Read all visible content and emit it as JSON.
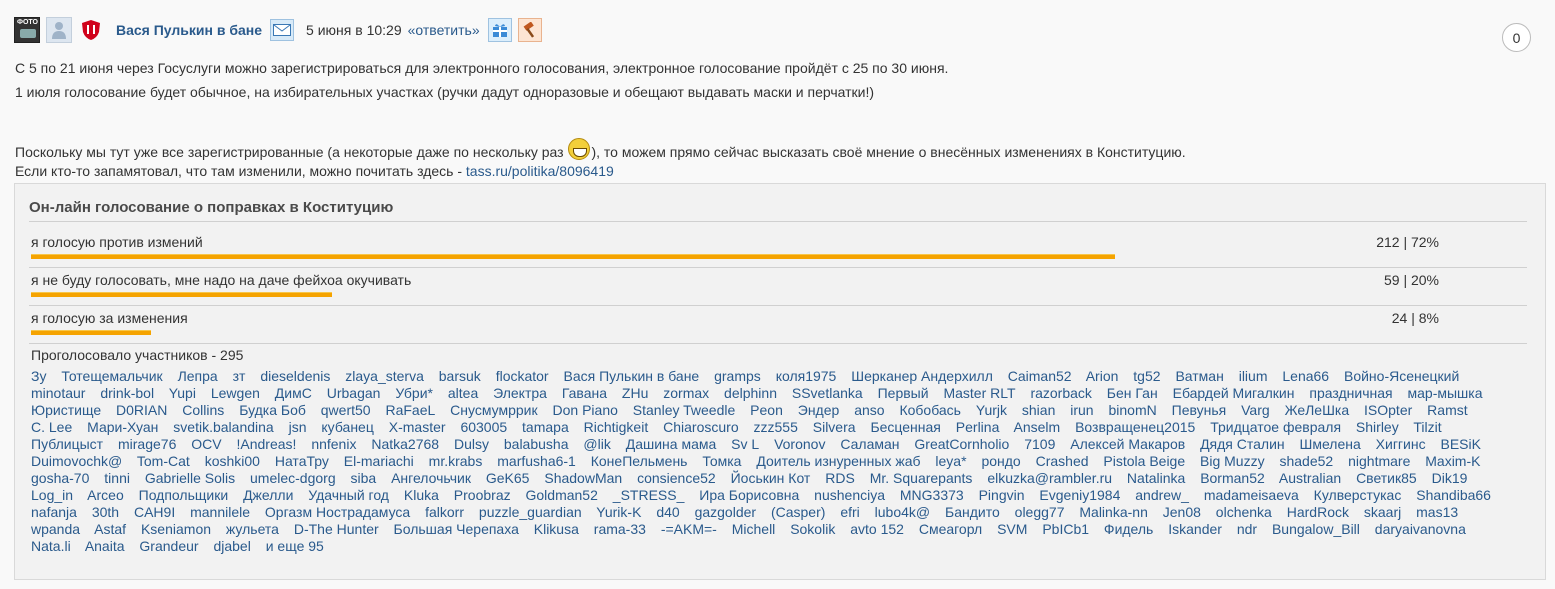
{
  "post": {
    "author": "Вася Пулькин в бане",
    "date": "5 июня в 10:29",
    "reply_label": "«ответить»",
    "counter": "0",
    "photo_badge": "ФОТО",
    "icons": [
      "photo-icon",
      "avatar-icon",
      "shield-icon",
      "mail-icon",
      "gift-icon",
      "hammer-icon"
    ],
    "paragraph1": "С 5 по 21 июня через Госуслуги можно зарегистрироваться для электронного голосования, электронное голосование пройдёт с 25 по 30 июня.",
    "paragraph2": "1 июля голосование будет обычное, на избирательных участках (ручки дадут одноразовые и обещают выдавать маски и перчатки!)",
    "paragraph3_before": "Поскольку мы тут уже все зарегистрированные (а некоторые даже по нескольку раз ",
    "paragraph3_after": "), то можем прямо сейчас высказать своё мнение о внесённых изменениях в Конституцию.",
    "paragraph4_text": "Если кто-то запамятовал, что там изменили, можно почитать здесь - ",
    "paragraph4_link": "tass.ru/politika/8096419"
  },
  "poll": {
    "title": "Он-лайн голосование о поправках в Коституцию",
    "options": [
      {
        "label": "я голосую против измений",
        "count": "212 | 72%",
        "percent": 72
      },
      {
        "label": "я не буду голосовать, мне надо на даче фейхоа окучивать",
        "count": "59 | 20%",
        "percent": 20
      },
      {
        "label": "я голосую за изменения",
        "count": "24 | 8%",
        "percent": 8
      }
    ],
    "voted_label": "Проголосовало участников - 295",
    "voters": [
      "Зу",
      "Тотещемальчик",
      "Лепра",
      "зт",
      "dieseldenis",
      "zlaya_sterva",
      "barsuk",
      "flockator",
      "Вася Пулькин в бане",
      "gramps",
      "коля1975",
      "Шерканер Андерхилл",
      "Caiman52",
      "Arion",
      "tg52",
      "Ватман",
      "ilium",
      "Lena66",
      "Войно-Ясенецкий",
      "minotaur",
      "drink-bol",
      "Yupi",
      "Lewgen",
      "ДимС",
      "Urbagan",
      "Убри*",
      "altea",
      "Электра",
      "Гавана",
      "ZHu",
      "zormax",
      "delphinn",
      "SSvetlanka",
      "Первый",
      "Master RLT",
      "razorback",
      "Бен Ган",
      "Ебардей Мигалкин",
      "праздничная",
      "мар-мышка",
      "Юристище",
      "D0RIAN",
      "Collins",
      "Будка Боб",
      "qwert50",
      "RaFaeL",
      "Снусмумррик",
      "Don Piano",
      "Stanley Tweedle",
      "Peon",
      "Эндер",
      "anso",
      "Кобобась",
      "Yurjk",
      "shian",
      "irun",
      "binomN",
      "Певунья",
      "Varg",
      "ЖеЛеШка",
      "ISOpter",
      "Ramst",
      "C. Lee",
      "Мари-Хуан",
      "svetik.balandina",
      "jsn",
      "кубанец",
      "X-master",
      "603005",
      "tamapa",
      "Richtigkeit",
      "Chiaroscuro",
      "zzz555",
      "Silvera",
      "Бесценная",
      "Perlina",
      "Anselm",
      "Возвращенец2015",
      "Тридцатое февраля",
      "Shirley",
      "Tilzit",
      "Публицыст",
      "mirage76",
      "OCV",
      "!Andreas!",
      "nnfenix",
      "Natka2768",
      "Dulsy",
      "balabusha",
      "@lik",
      "Дашина мама",
      "Sv L",
      "Voronov",
      "Саламан",
      "GreatCornholio",
      "7109",
      "Алексей Макаров",
      "Дядя Сталин",
      "Шмелена",
      "Хиггинс",
      "BESiK",
      "Duimovochk@",
      "Tom-Cat",
      "koshki00",
      "НатаТру",
      "El-mariachi",
      "mr.krabs",
      "marfusha6-1",
      "КонеПельмень",
      "Томка",
      "Доитель изнуренных жаб",
      "leya*",
      "рондо",
      "Crashed",
      "Pistola Beige",
      "Big Muzzy",
      "shade52",
      "nightmare",
      "Maxim-K",
      "gosha-70",
      "tinni",
      "Gabrielle Solis",
      "umelec-dgorg",
      "siba",
      "Ангелочьчик",
      "GeK65",
      "ShadowMan",
      "consience52",
      "Йоськин Кот",
      "RDS",
      "Mr. Squarepants",
      "elkuzka@rambler.ru",
      "Natalinka",
      "Borman52",
      "Australian",
      "Светик85",
      "Dik19",
      "Log_in",
      "Arceo",
      "Подпольщики",
      "Джелли",
      "Удачный год",
      "Kluka",
      "Proobraz",
      "Goldman52",
      "_STRESS_",
      "Ира Борисовна",
      "nushenciya",
      "MNG3373",
      "Pingvin",
      "Evgeniy1984",
      "andrew_",
      "madameisaeva",
      "Кулверстукас",
      "Shandiba66",
      "nafanja",
      "30th",
      "CAH9I",
      "mannilele",
      "Оргазм Нострадамуса",
      "falkorr",
      "puzzle_guardian",
      "Yurik-K",
      "d40",
      "gazgolder",
      "(Casper)",
      "efri",
      "lubo4k@",
      "Бандито",
      "olegg77",
      "Malinka-nn",
      "Jen08",
      "olchenka",
      "HardRock",
      "skaarj",
      "mas13",
      "wpanda",
      "Astaf",
      "Kseniamon",
      "жульета",
      "D-The Hunter",
      "Большая Черепаха",
      "Klikusa",
      "rama-33",
      "-=AKM=-",
      "Michell",
      "Sokolik",
      "avto 152",
      "Смеагорл",
      "SVM",
      "PbICb1",
      "Фидель",
      "Iskander",
      "ndr",
      "Bungalow_Bill",
      "daryaivanovna",
      "Nata.li",
      "Anaita",
      "Grandeur",
      "djabel",
      "и еще 95"
    ]
  },
  "colors": {
    "link": "#2a5a8c",
    "bar": "#f5a300",
    "background": "#f9f9f9",
    "poll_background": "#f2f2f2"
  }
}
